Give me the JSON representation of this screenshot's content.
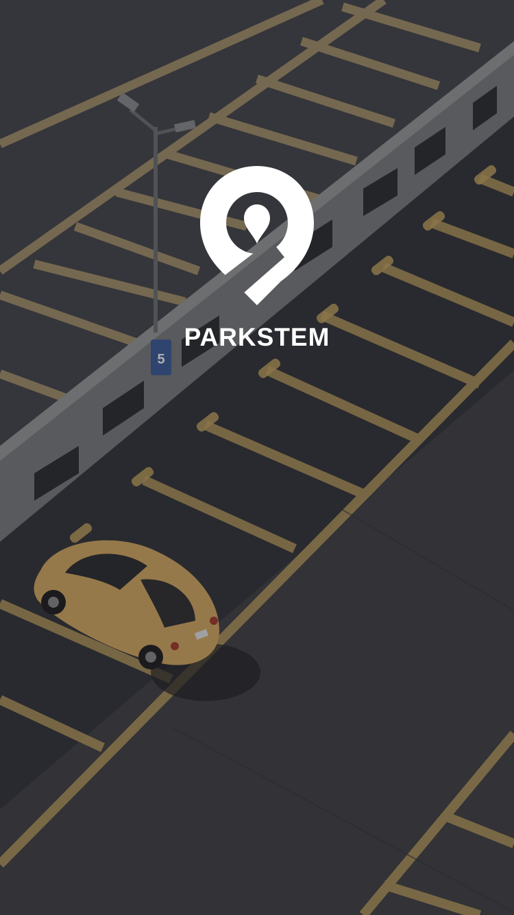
{
  "app": {
    "brand_name": "PARKSTEM",
    "logo_icon": "map-pin-p-logo-icon"
  },
  "background": {
    "scene": "parking-garage-aerial-image",
    "level_sign_label": "5",
    "colors": {
      "asphalt": "#3f4044",
      "asphalt_dark": "#2f3034",
      "line_yellow": "#c9a860",
      "car_yellow": "#e2b769",
      "wall": "#8a8b8c",
      "sign_blue": "#3b5b9a"
    }
  }
}
